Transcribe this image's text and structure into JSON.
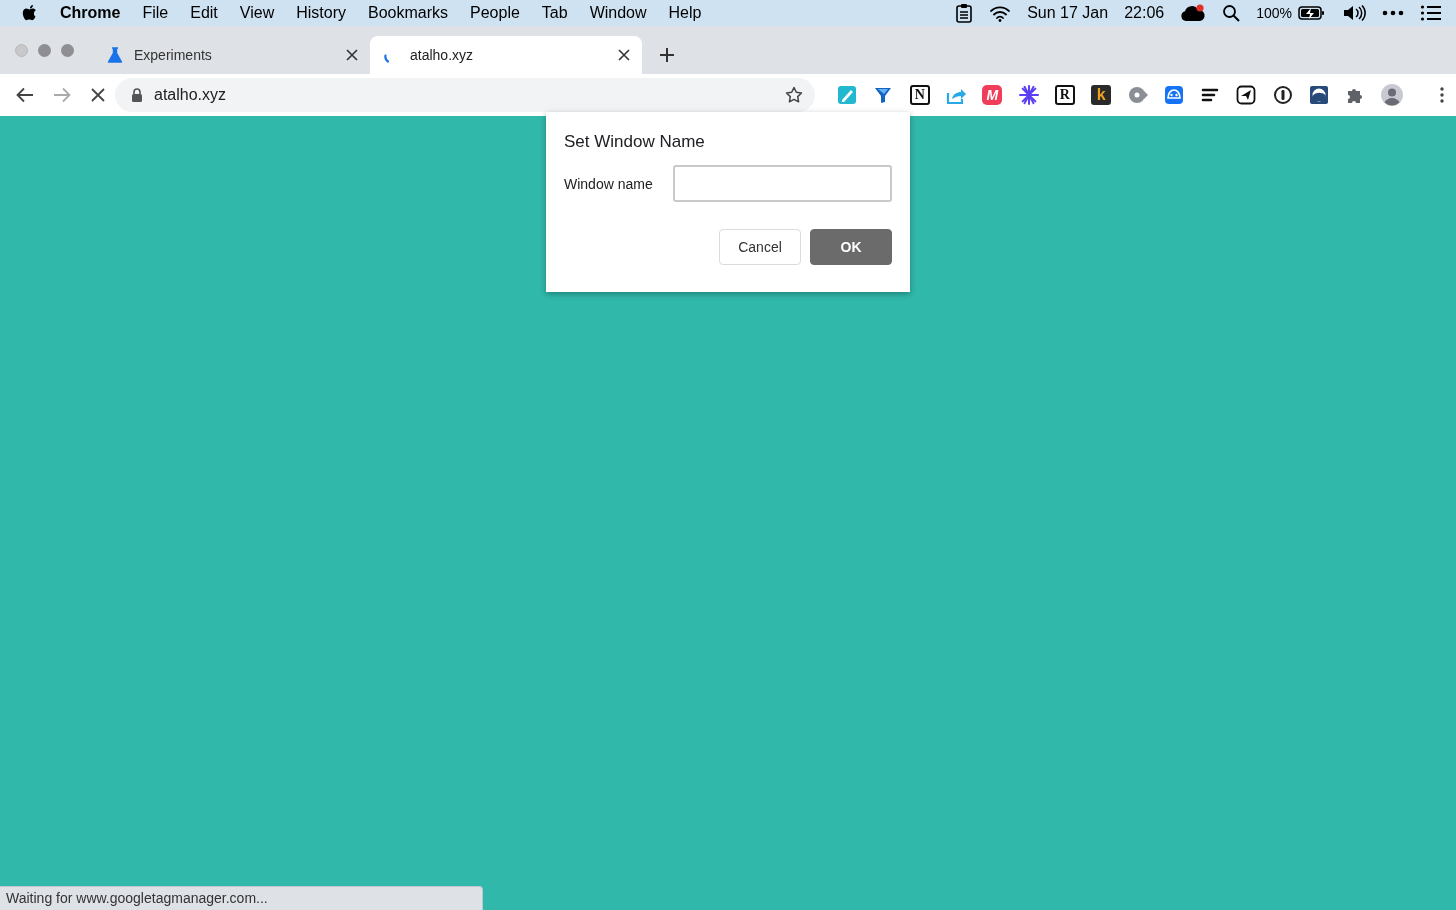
{
  "menu_bar": {
    "app": "Chrome",
    "items": [
      "File",
      "Edit",
      "View",
      "History",
      "Bookmarks",
      "People",
      "Tab",
      "Window",
      "Help"
    ],
    "date": "Sun 17 Jan",
    "time": "22:06",
    "battery": "100%"
  },
  "tabs": [
    {
      "title": "Experiments",
      "selected": false,
      "kind": "flask"
    },
    {
      "title": "atalho.xyz",
      "selected": true,
      "kind": "loading"
    }
  ],
  "toolbar": {
    "url": "atalho.xyz",
    "extensions": [
      {
        "kind": "pen"
      },
      {
        "kind": "funnel"
      },
      {
        "kind": "letter",
        "label": "N"
      },
      {
        "kind": "share"
      },
      {
        "kind": "m",
        "label": "M"
      },
      {
        "kind": "burst"
      },
      {
        "kind": "letter",
        "label": "R"
      },
      {
        "kind": "k",
        "label": "k"
      },
      {
        "kind": "record"
      },
      {
        "kind": "face"
      },
      {
        "kind": "lines"
      },
      {
        "kind": "plane"
      },
      {
        "kind": "ring"
      },
      {
        "kind": "wave"
      },
      {
        "kind": "puzzle"
      },
      {
        "kind": "avatar"
      }
    ]
  },
  "dialog": {
    "title": "Set Window Name",
    "field_label": "Window name",
    "buttons": [
      {
        "label": "Cancel",
        "kind": "secondary"
      },
      {
        "label": "OK",
        "kind": "primary"
      }
    ]
  },
  "status_bar": "Waiting for www.googletagmanager.com..."
}
